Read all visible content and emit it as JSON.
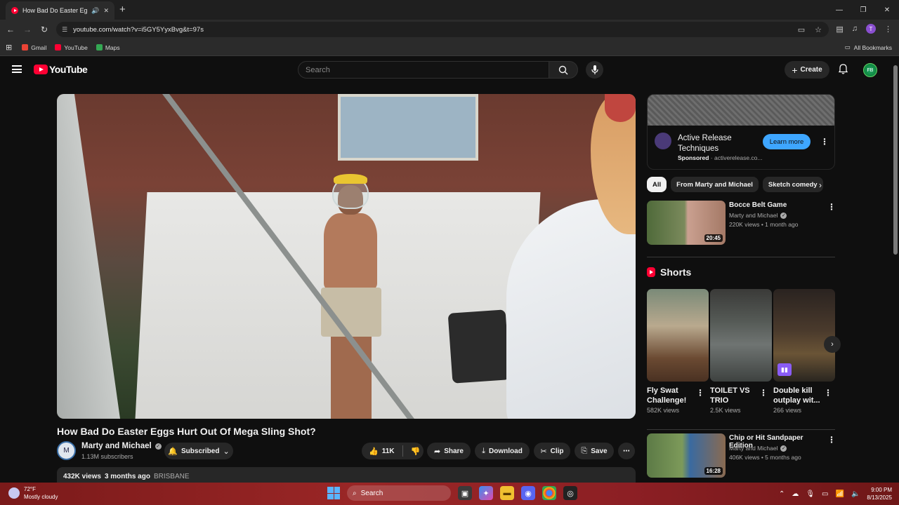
{
  "browser": {
    "tab_title": "How Bad Do Easter Eggs H",
    "url": "youtube.com/watch?v=i5GY5YyxBvg&t=97s",
    "bookmarks": [
      {
        "label": "Gmail",
        "color": "#ea4335"
      },
      {
        "label": "YouTube",
        "color": "#ff0033"
      },
      {
        "label": "Maps",
        "color": "#34a853"
      }
    ],
    "all_bookmarks": "All Bookmarks",
    "profile_initial": "T"
  },
  "youtube": {
    "logo_text": "YouTube",
    "search_placeholder": "Search",
    "create_label": "Create",
    "avatar_text": "FB"
  },
  "video": {
    "title": "How Bad Do Easter Eggs Hurt Out Of Mega Sling Shot?",
    "channel": "Marty and Michael",
    "subscribers": "1.13M subscribers",
    "subscribed_label": "Subscribed",
    "likes": "11K",
    "share_label": "Share",
    "download_label": "Download",
    "clip_label": "Clip",
    "save_label": "Save",
    "views": "432K views",
    "age": "3 months ago",
    "location": "BRISBANE"
  },
  "ad": {
    "name": "Active Release Techniques",
    "sponsored": "Sponsored",
    "domain": "activerelease.co...",
    "cta": "Learn more"
  },
  "chips": [
    "All",
    "From Marty and Michael",
    "Sketch comedy"
  ],
  "recommendations": [
    {
      "title": "Bocce Belt Game",
      "channel": "Marty and Michael",
      "meta": "220K views • 1 month ago",
      "duration": "20:45"
    },
    {
      "title": "Chip or Hit Sandpaper Edition",
      "channel": "Marty and Michael",
      "meta": "406K views • 5 months ago",
      "duration": "16:28"
    }
  ],
  "shorts": {
    "heading": "Shorts",
    "items": [
      {
        "title": "Fly Swat Challenge!",
        "views": "582K views"
      },
      {
        "title": "TOILET VS TRIO",
        "views": "2.5K views"
      },
      {
        "title": "Double kill outplay wit...",
        "views": "266 views"
      }
    ]
  },
  "taskbar": {
    "temp": "72°F",
    "condition": "Mostly cloudy",
    "search_label": "Search",
    "time": "9:00 PM",
    "date": "8/13/2025"
  }
}
